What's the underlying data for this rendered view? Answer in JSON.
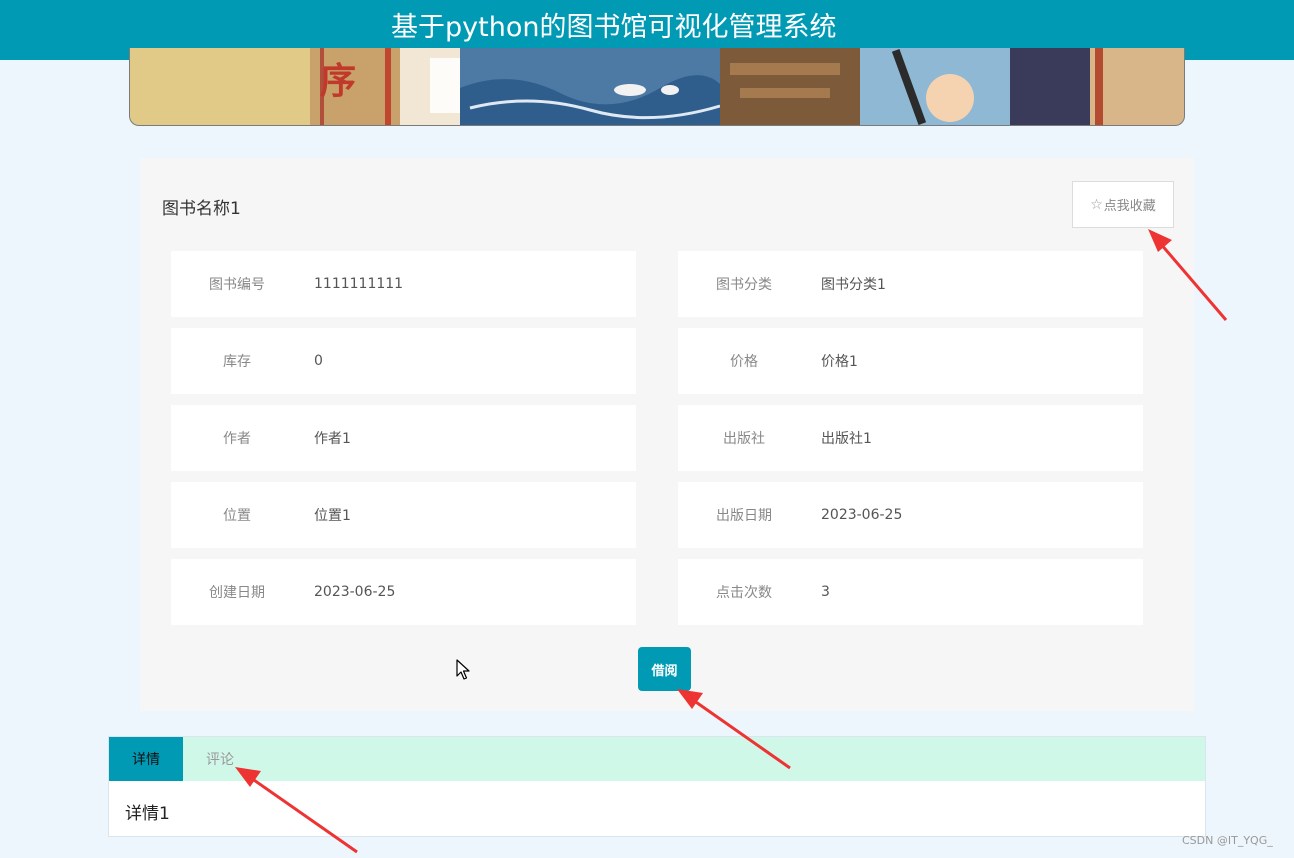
{
  "header": {
    "title": "基于python的图书馆可视化管理系统"
  },
  "banner": {
    "text": "序"
  },
  "book": {
    "name": "图书名称1",
    "favorite_label": "点我收藏",
    "favorite_icon": "star-outline-icon",
    "fields": [
      {
        "label": "图书编号",
        "value": "1111111111"
      },
      {
        "label": "图书分类",
        "value": "图书分类1"
      },
      {
        "label": "库存",
        "value": "0"
      },
      {
        "label": "价格",
        "value": "价格1"
      },
      {
        "label": "作者",
        "value": "作者1"
      },
      {
        "label": "出版社",
        "value": "出版社1"
      },
      {
        "label": "位置",
        "value": "位置1"
      },
      {
        "label": "出版日期",
        "value": "2023-06-25"
      },
      {
        "label": "创建日期",
        "value": "2023-06-25"
      },
      {
        "label": "点击次数",
        "value": "3"
      }
    ],
    "borrow_label": "借阅"
  },
  "tabs": {
    "items": [
      {
        "label": "详情",
        "active": true
      },
      {
        "label": "评论",
        "active": false
      }
    ],
    "content": "详情1"
  },
  "watermark": "CSDN @IT_YQG_",
  "colors": {
    "accent": "#009ab5",
    "tab_bar": "#d0f8e9",
    "annotation_arrow": "#ee3333"
  }
}
